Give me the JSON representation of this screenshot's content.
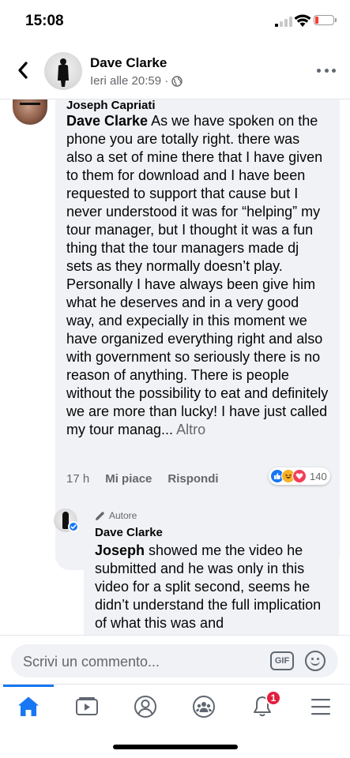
{
  "status_bar": {
    "time": "15:08"
  },
  "post": {
    "author_name": "Dave Clarke",
    "timestamp": "Ieri alle 20:59 ·"
  },
  "comments": [
    {
      "author": "Joseph Capriati",
      "mention": "Dave Clarke",
      "text": " As we have spoken on the phone you are totally right. there was also a set of mine there that I have given to them for download and I have been requested to support that cause but I never understood it was for “helping” my tour manager, but I thought it was a fun thing that the tour managers made dj sets as they normally doesn’t play. Personally I have always been give him what he deserves and in a very good way, and expecially in this moment we have organized everything right and also with government so seriously there is no reason of anything. There is people without the possibility to eat and definitely we are more than lucky! I have just called my tour manag...",
      "more_label": "Altro",
      "time": "17 h",
      "like_label": "Mi piace",
      "reply_label": "Rispondi",
      "reaction_count": "140"
    },
    {
      "author_tag": "Autore",
      "author": "Dave Clarke",
      "mention": "Joseph",
      "text": " showed me the video he submitted and he was only in this video for a split second, seems he didn’t understand the full implication of what this was and"
    }
  ],
  "composer": {
    "placeholder": "Scrivi un commento...",
    "gif_label": "GIF"
  },
  "nav": {
    "items": [
      "home",
      "watch",
      "profile",
      "groups",
      "notifications",
      "menu"
    ],
    "active": "home",
    "notification_count": "1"
  },
  "colors": {
    "accent": "#1877f2",
    "bubble": "#f0f2f5",
    "secondary_text": "#65676b",
    "badge": "#e41e3f"
  }
}
